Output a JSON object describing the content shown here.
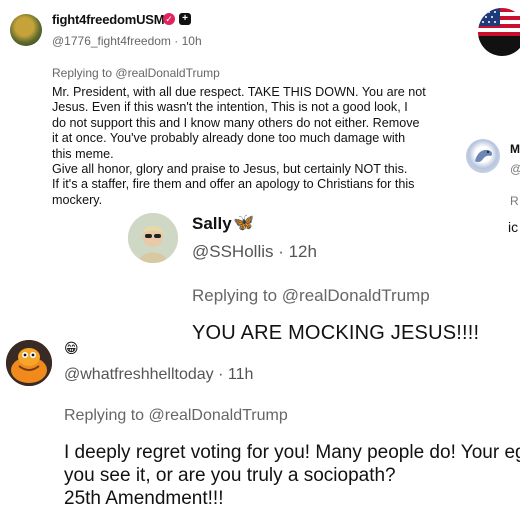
{
  "post1": {
    "display_name": "fight4freedomUSMC",
    "badge_check_glyph": "✓",
    "badge_plus_glyph": "+",
    "handle": "@1776_fight4freedom · 10h",
    "replying_prefix": "Replying to",
    "replying_mention": "@realDonaldTrump",
    "body_lines": [
      "Mr. President, with all due respect. TAKE THIS DOWN. You are not",
      "Jesus. Even if this wasn't the intention, This is not a good look, I",
      "do not support this and I know many others do not either. Remove",
      "it at once. You've probably already done too much damage with",
      "this meme.",
      "Give all honor, glory and praise to Jesus, but certainly NOT this.",
      "If it's a staffer, fire them and offer an apology  to Christians for this",
      "mockery."
    ]
  },
  "edge": {
    "name_fragment": "M",
    "handle_fragment": "@",
    "replying_fragment": "R",
    "body_fragment": "ic",
    "flag_icon": "us-flag-avatar"
  },
  "post2": {
    "display_name": "Sally",
    "name_emoji": "🦋",
    "handle": "@SSHollis · 12h",
    "replying_prefix": "Replying to",
    "replying_mention": "@realDonaldTrump",
    "body": "YOU ARE MOCKING JESUS!!!!"
  },
  "post3": {
    "display_name_emoji": "😁",
    "handle": "@whatfreshhelltoday · 11h",
    "replying_prefix": "Replying to",
    "replying_mention": "@realDonaldTrump",
    "body_lines": [
      "I deeply regret voting for you! Many people do! Your eg",
      "you see it, or are you truly a sociopath?",
      "25th Amendment!!!"
    ]
  },
  "colors": {
    "verified_badge": "#e0245e",
    "muted_text": "#666666",
    "butterfly": "#3b8ee6"
  }
}
